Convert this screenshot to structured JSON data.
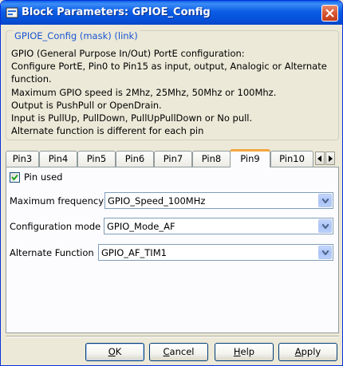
{
  "window": {
    "title": "Block Parameters: GPIOE_Config",
    "icon": "block-parameters-icon",
    "close_icon": "close-icon"
  },
  "mask": {
    "group_title": "GPIOE_Config (mask) (link)",
    "description": [
      "GPIO (General Purpose In/Out) PortE configuration:",
      "Configure PortE, Pin0 to Pin15 as input, output, Analogic or Alternate",
      "function.",
      "Maximum GPIO speed is 2Mhz, 25Mhz, 50Mhz or 100Mhz.",
      "Output is PushPull or OpenDrain.",
      "Input is PullUp, PullDown, PullUpPullDown or No pull.",
      "Alternate function is different for each pin"
    ]
  },
  "tabs": {
    "items": [
      "Pin3",
      "Pin4",
      "Pin5",
      "Pin6",
      "Pin7",
      "Pin8",
      "Pin9",
      "Pin10"
    ],
    "active": "Pin9"
  },
  "panel": {
    "pin_used": {
      "label": "Pin used",
      "checked": true
    },
    "max_frequency": {
      "label": "Maximum frequency",
      "value": "GPIO_Speed_100MHz"
    },
    "config_mode": {
      "label": "Configuration mode",
      "value": "GPIO_Mode_AF"
    },
    "alt_function": {
      "label": "Alternate Function",
      "value": "GPIO_AF_TIM1"
    }
  },
  "buttons": {
    "ok": {
      "label": "OK",
      "mnemonic_index": 0
    },
    "cancel": {
      "label": "Cancel",
      "mnemonic_index": 0
    },
    "help": {
      "label": "Help",
      "mnemonic_index": 0
    },
    "apply": {
      "label": "Apply",
      "mnemonic_index": 0
    }
  },
  "colors": {
    "titlebar": "#0b5de6",
    "group_title": "#1a55d4",
    "active_tab_accent": "#f3a63f",
    "dialog_bg": "#ece9d8"
  }
}
